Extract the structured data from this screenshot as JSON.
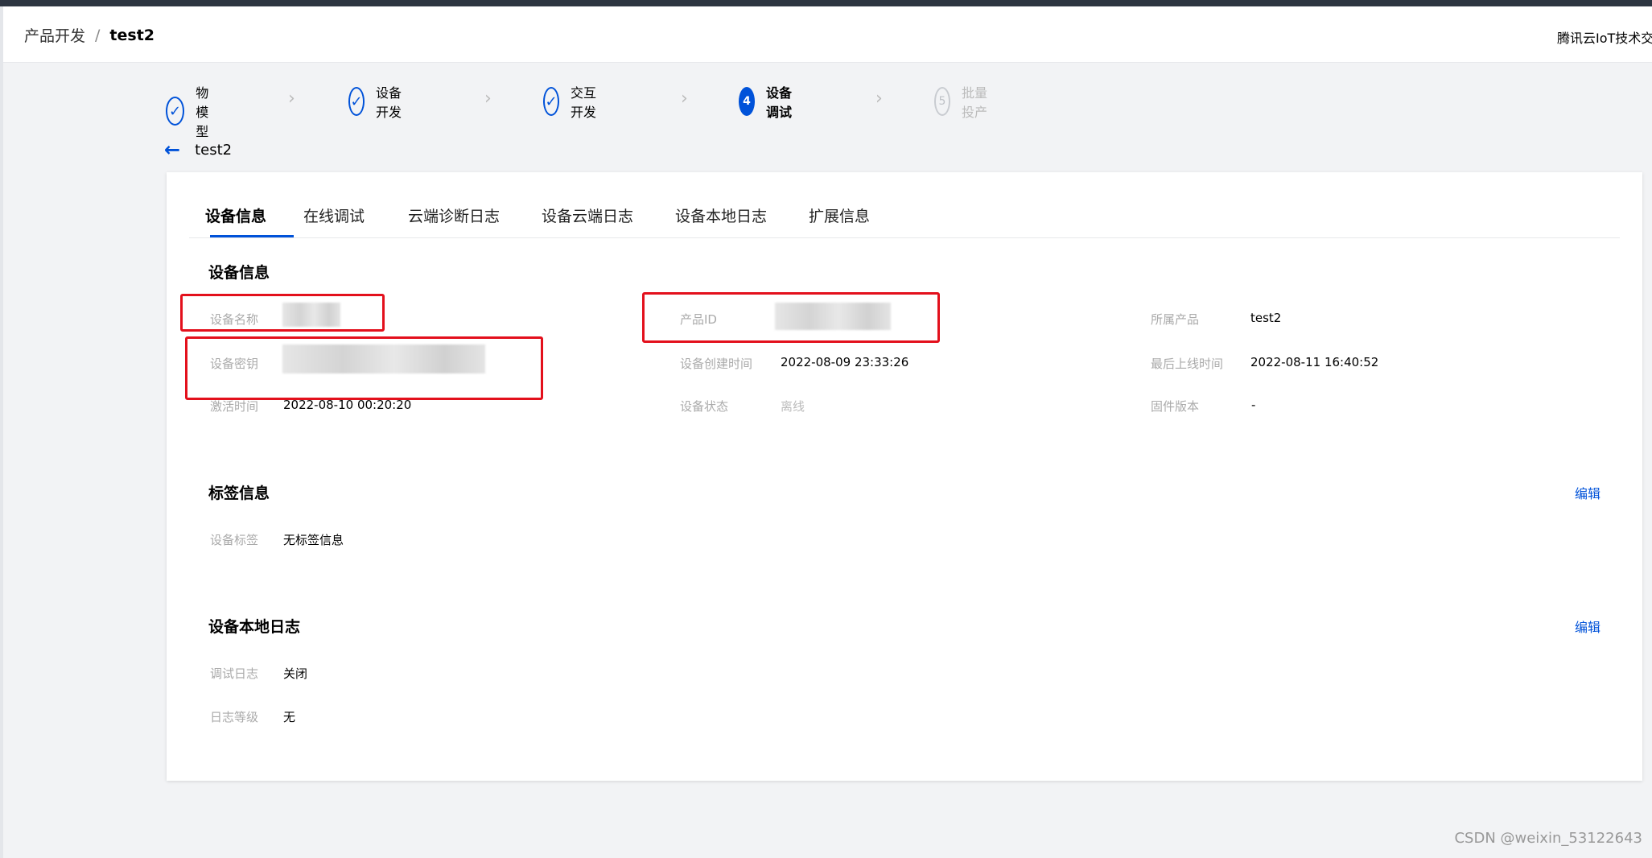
{
  "header": {
    "breadcrumb_parent": "产品开发",
    "breadcrumb_sep": "/",
    "breadcrumb_current": "test2",
    "right_text": "腾讯云IoT技术交"
  },
  "steps": [
    {
      "label": "物模型",
      "state": "done",
      "icon": "check-icon"
    },
    {
      "label": "设备开发",
      "state": "done",
      "icon": "check-icon"
    },
    {
      "label": "交互开发",
      "state": "done",
      "icon": "check-icon"
    },
    {
      "label": "设备调试",
      "state": "active",
      "number": "4"
    },
    {
      "label": "批量投产",
      "state": "pending",
      "number": "5"
    }
  ],
  "page": {
    "back_title": "test2"
  },
  "tabs": [
    "设备信息",
    "在线调试",
    "云端诊断日志",
    "设备云端日志",
    "设备本地日志",
    "扩展信息"
  ],
  "device_info": {
    "title": "设备信息",
    "fields": {
      "device_name_label": "设备名称",
      "product_id_label": "产品ID",
      "product_label": "所属产品",
      "product_value": "test2",
      "secret_label": "设备密钥",
      "created_label": "设备创建时间",
      "created_value": "2022-08-09 23:33:26",
      "last_online_label": "最后上线时间",
      "last_online_value": "2022-08-11 16:40:52",
      "activated_label": "激活时间",
      "activated_value": "2022-08-10 00:20:20",
      "status_label": "设备状态",
      "status_value": "离线",
      "firmware_label": "固件版本",
      "firmware_value": "-"
    }
  },
  "tag_info": {
    "title": "标签信息",
    "edit_label": "编辑",
    "tag_label": "设备标签",
    "tag_value": "无标签信息"
  },
  "local_log": {
    "title": "设备本地日志",
    "edit_label": "编辑",
    "debug_label": "调试日志",
    "debug_value": "关闭",
    "level_label": "日志等级",
    "level_value": "无"
  },
  "watermark": "CSDN @weixin_53122643",
  "colors": {
    "accent": "#0052d9",
    "highlight_box": "#e3101c",
    "topbar": "#2d3541"
  }
}
